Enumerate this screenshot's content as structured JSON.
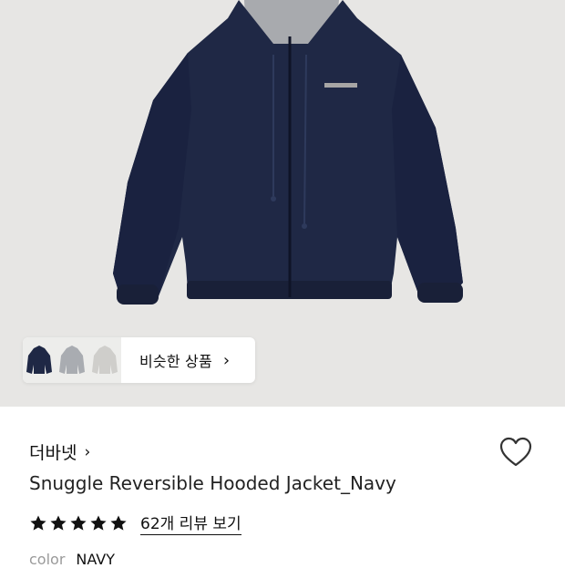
{
  "hero": {
    "image_icon": "navy-hooded-jacket-image"
  },
  "similar": {
    "label": "비슷한 상품",
    "chevron": "›",
    "thumbs": [
      "navy-jacket-thumb",
      "gray-jacket-thumb",
      "light-gray-jacket-thumb"
    ]
  },
  "product": {
    "brand": "더바넷",
    "brand_chevron": "›",
    "title": "Snuggle Reversible Hooded Jacket_Navy",
    "rating": 5,
    "review_link": "62개 리뷰 보기",
    "color_label": "color",
    "color_value": "NAVY"
  },
  "colors": {
    "navy": "#1f2845",
    "background": "#e7e6e4"
  }
}
